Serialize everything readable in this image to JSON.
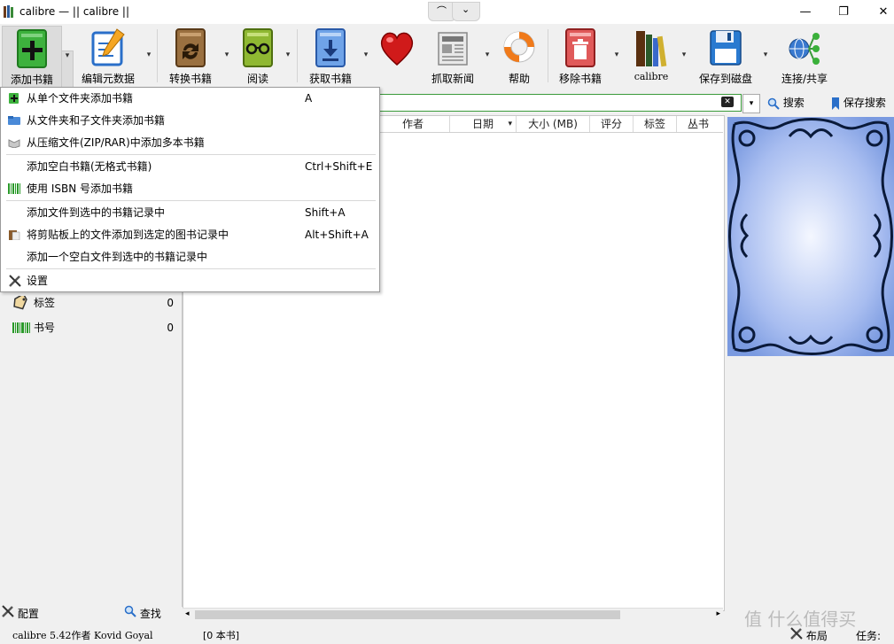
{
  "window": {
    "title": "calibre — || calibre ||",
    "controls": {
      "minimize": "—",
      "maximize": "❐",
      "close": "✕"
    }
  },
  "quick_access": {
    "left": "⌒",
    "right": "⌄"
  },
  "toolbar": {
    "buttons": [
      {
        "label": "添加书籍",
        "icon": "add-book-icon"
      },
      {
        "label": "编辑元数据",
        "icon": "edit-metadata-icon"
      },
      {
        "label": "转换书籍",
        "icon": "convert-book-icon"
      },
      {
        "label": "阅读",
        "icon": "read-book-icon"
      },
      {
        "label": "获取书籍",
        "icon": "get-books-icon"
      },
      {
        "label": "",
        "icon": "donate-heart-icon"
      },
      {
        "label": "抓取新闻",
        "icon": "fetch-news-icon"
      },
      {
        "label": "帮助",
        "icon": "help-lifebuoy-icon"
      },
      {
        "label": "移除书籍",
        "icon": "remove-books-icon"
      },
      {
        "label": "calibre",
        "icon": "library-icon"
      },
      {
        "label": "保存到磁盘",
        "icon": "save-to-disk-icon"
      },
      {
        "label": "连接/共享",
        "icon": "connect-share-icon"
      }
    ],
    "dropdown_glyph": "▾"
  },
  "search": {
    "value": "",
    "clear_glyph": "✕",
    "search_label": "搜索",
    "save_search_label": "保存搜索"
  },
  "table": {
    "columns": [
      "作者",
      "日期",
      "大小 (MB)",
      "评分",
      "标签",
      "丛书"
    ]
  },
  "tag_browser": {
    "items": [
      {
        "label": "标签",
        "count": "0",
        "icon": "tag-icon"
      },
      {
        "label": "书号",
        "count": "0",
        "icon": "barcode-icon"
      }
    ],
    "configure_label": "配置",
    "find_label": "查找"
  },
  "add_menu": {
    "items": [
      {
        "label": "从单个文件夹添加书籍",
        "shortcut": "A",
        "icon": "add-book-icon"
      },
      {
        "label": "从文件夹和子文件夹添加书籍",
        "shortcut": "",
        "icon": "folder-icon"
      },
      {
        "label": "从压缩文件(ZIP/RAR)中添加多本书籍",
        "shortcut": "",
        "icon": "archive-icon"
      },
      {
        "label": "添加空白书籍(无格式书籍)",
        "shortcut": "Ctrl+Shift+E",
        "icon": ""
      },
      {
        "label": "使用 ISBN 号添加书籍",
        "shortcut": "",
        "icon": "barcode-icon"
      },
      {
        "label": "添加文件到选中的书籍记录中",
        "shortcut": "Shift+A",
        "icon": ""
      },
      {
        "label": "将剪贴板上的文件添加到选定的图书记录中",
        "shortcut": "Alt+Shift+A",
        "icon": "clipboard-icon"
      },
      {
        "label": "添加一个空白文件到选中的书籍记录中",
        "shortcut": "",
        "icon": ""
      },
      {
        "label": "设置",
        "shortcut": "",
        "icon": "settings-icon"
      }
    ]
  },
  "status": {
    "version": "calibre 5.42作者 Kovid Goyal",
    "count": "[0 本书]",
    "layout_label": "布局",
    "jobs_label": "任务:"
  },
  "watermark": "值 什么值得买",
  "colors": {
    "toolbar_bg": "#f0f0f0",
    "search_border": "#3a9a3a",
    "cover_blue": "#7a9ae0"
  }
}
